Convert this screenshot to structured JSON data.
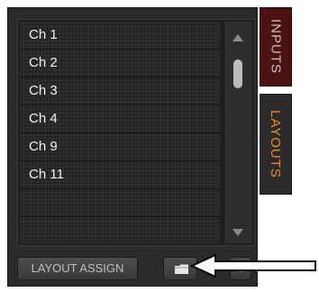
{
  "layouts": {
    "items": [
      {
        "label": "Ch 1"
      },
      {
        "label": "Ch 2"
      },
      {
        "label": "Ch 3"
      },
      {
        "label": "Ch 4"
      },
      {
        "label": "Ch 9"
      },
      {
        "label": "Ch 11"
      },
      {
        "label": ""
      },
      {
        "label": ""
      }
    ]
  },
  "tabs": {
    "inputs": "INPUTS",
    "layouts": "LAYOUTS",
    "active": "layouts"
  },
  "buttons": {
    "layout_assign": "LAYOUT ASSIGN",
    "folder_icon": "folder-icon",
    "dropdown_icon": "chevron-down-icon"
  },
  "colors": {
    "active_tab_text": "#ef8a1e",
    "inputs_tab_bg": "#4a1212"
  }
}
